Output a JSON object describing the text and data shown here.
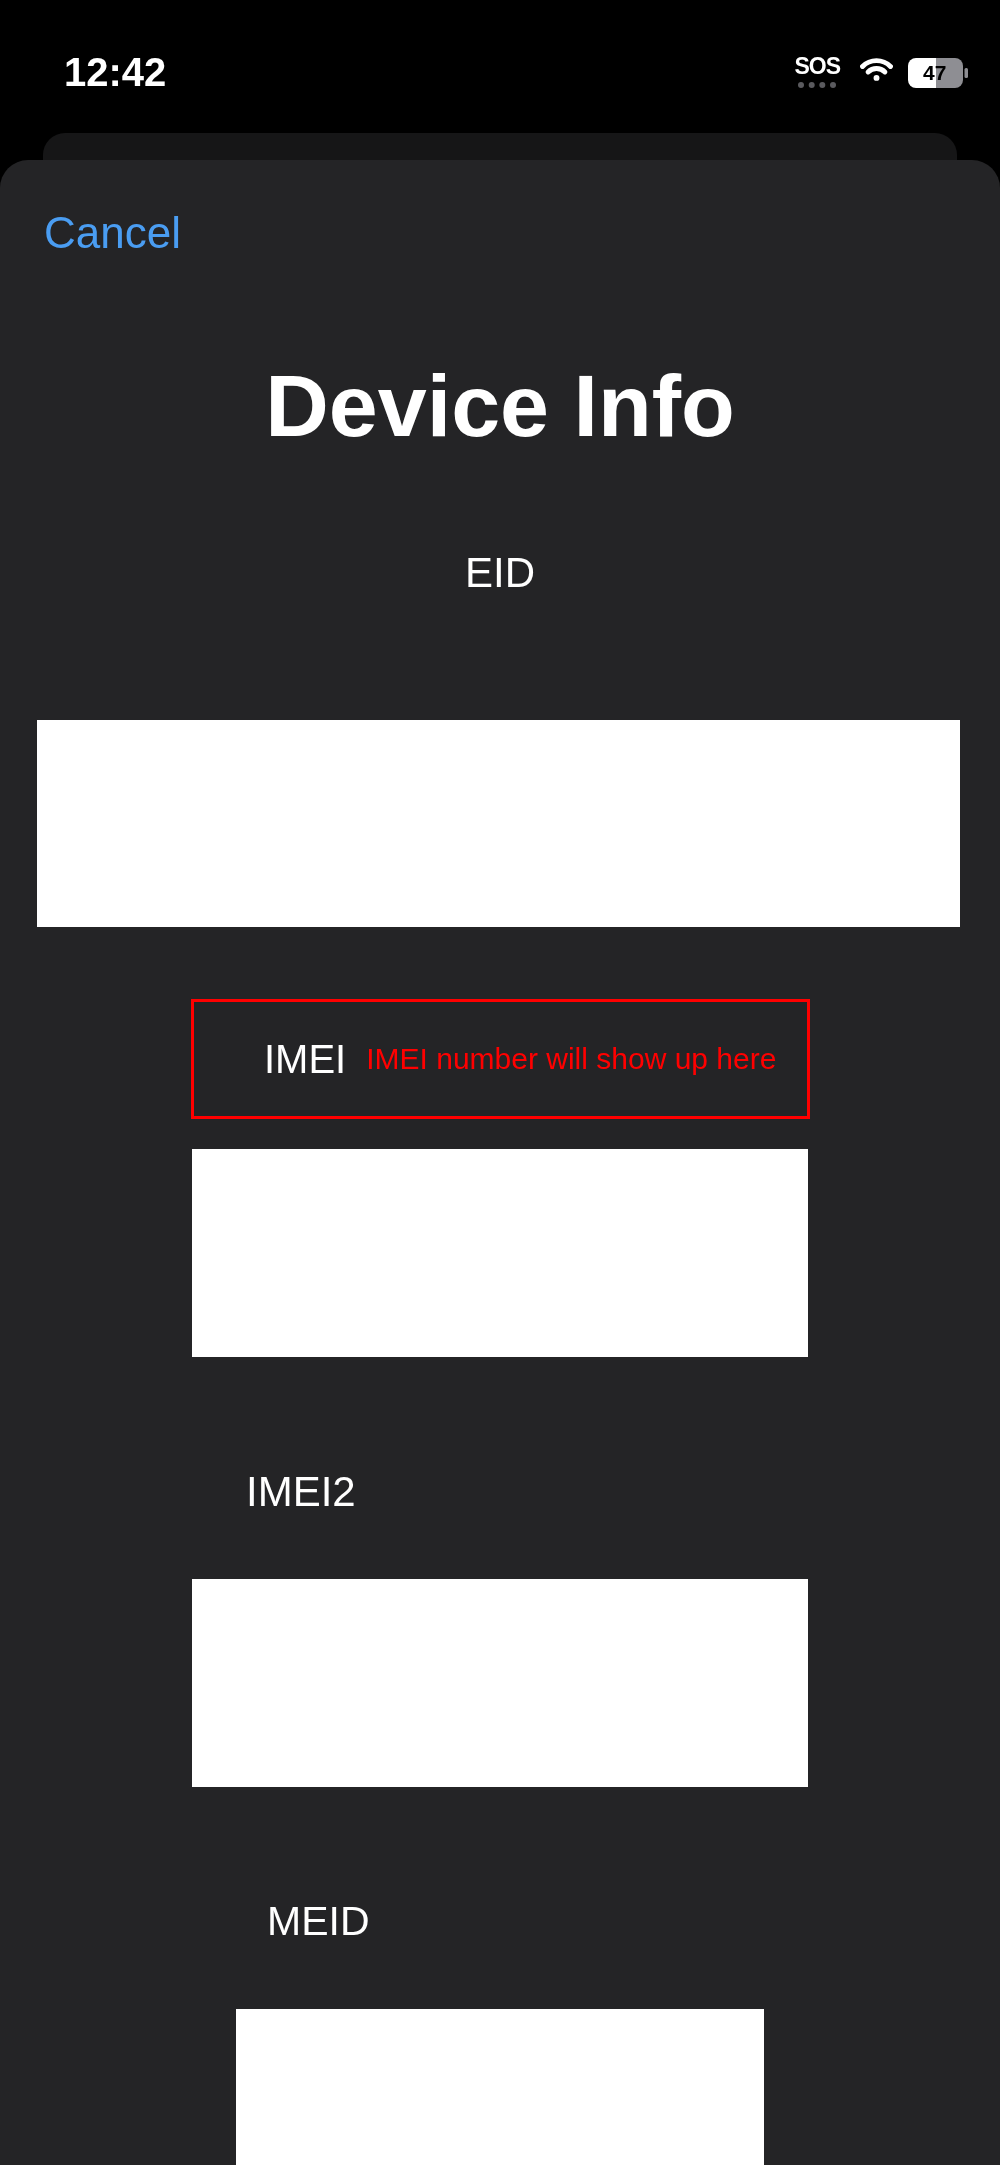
{
  "status_bar": {
    "time": "12:42",
    "network_status": "SOS",
    "battery": "47"
  },
  "sheet": {
    "cancel_button": "Cancel",
    "title": "Device Info",
    "fields": [
      {
        "label": "EID"
      },
      {
        "label": "IMEI",
        "annotation": "IMEI number will show up here"
      },
      {
        "label": "IMEI2"
      },
      {
        "label": "MEID"
      }
    ]
  }
}
